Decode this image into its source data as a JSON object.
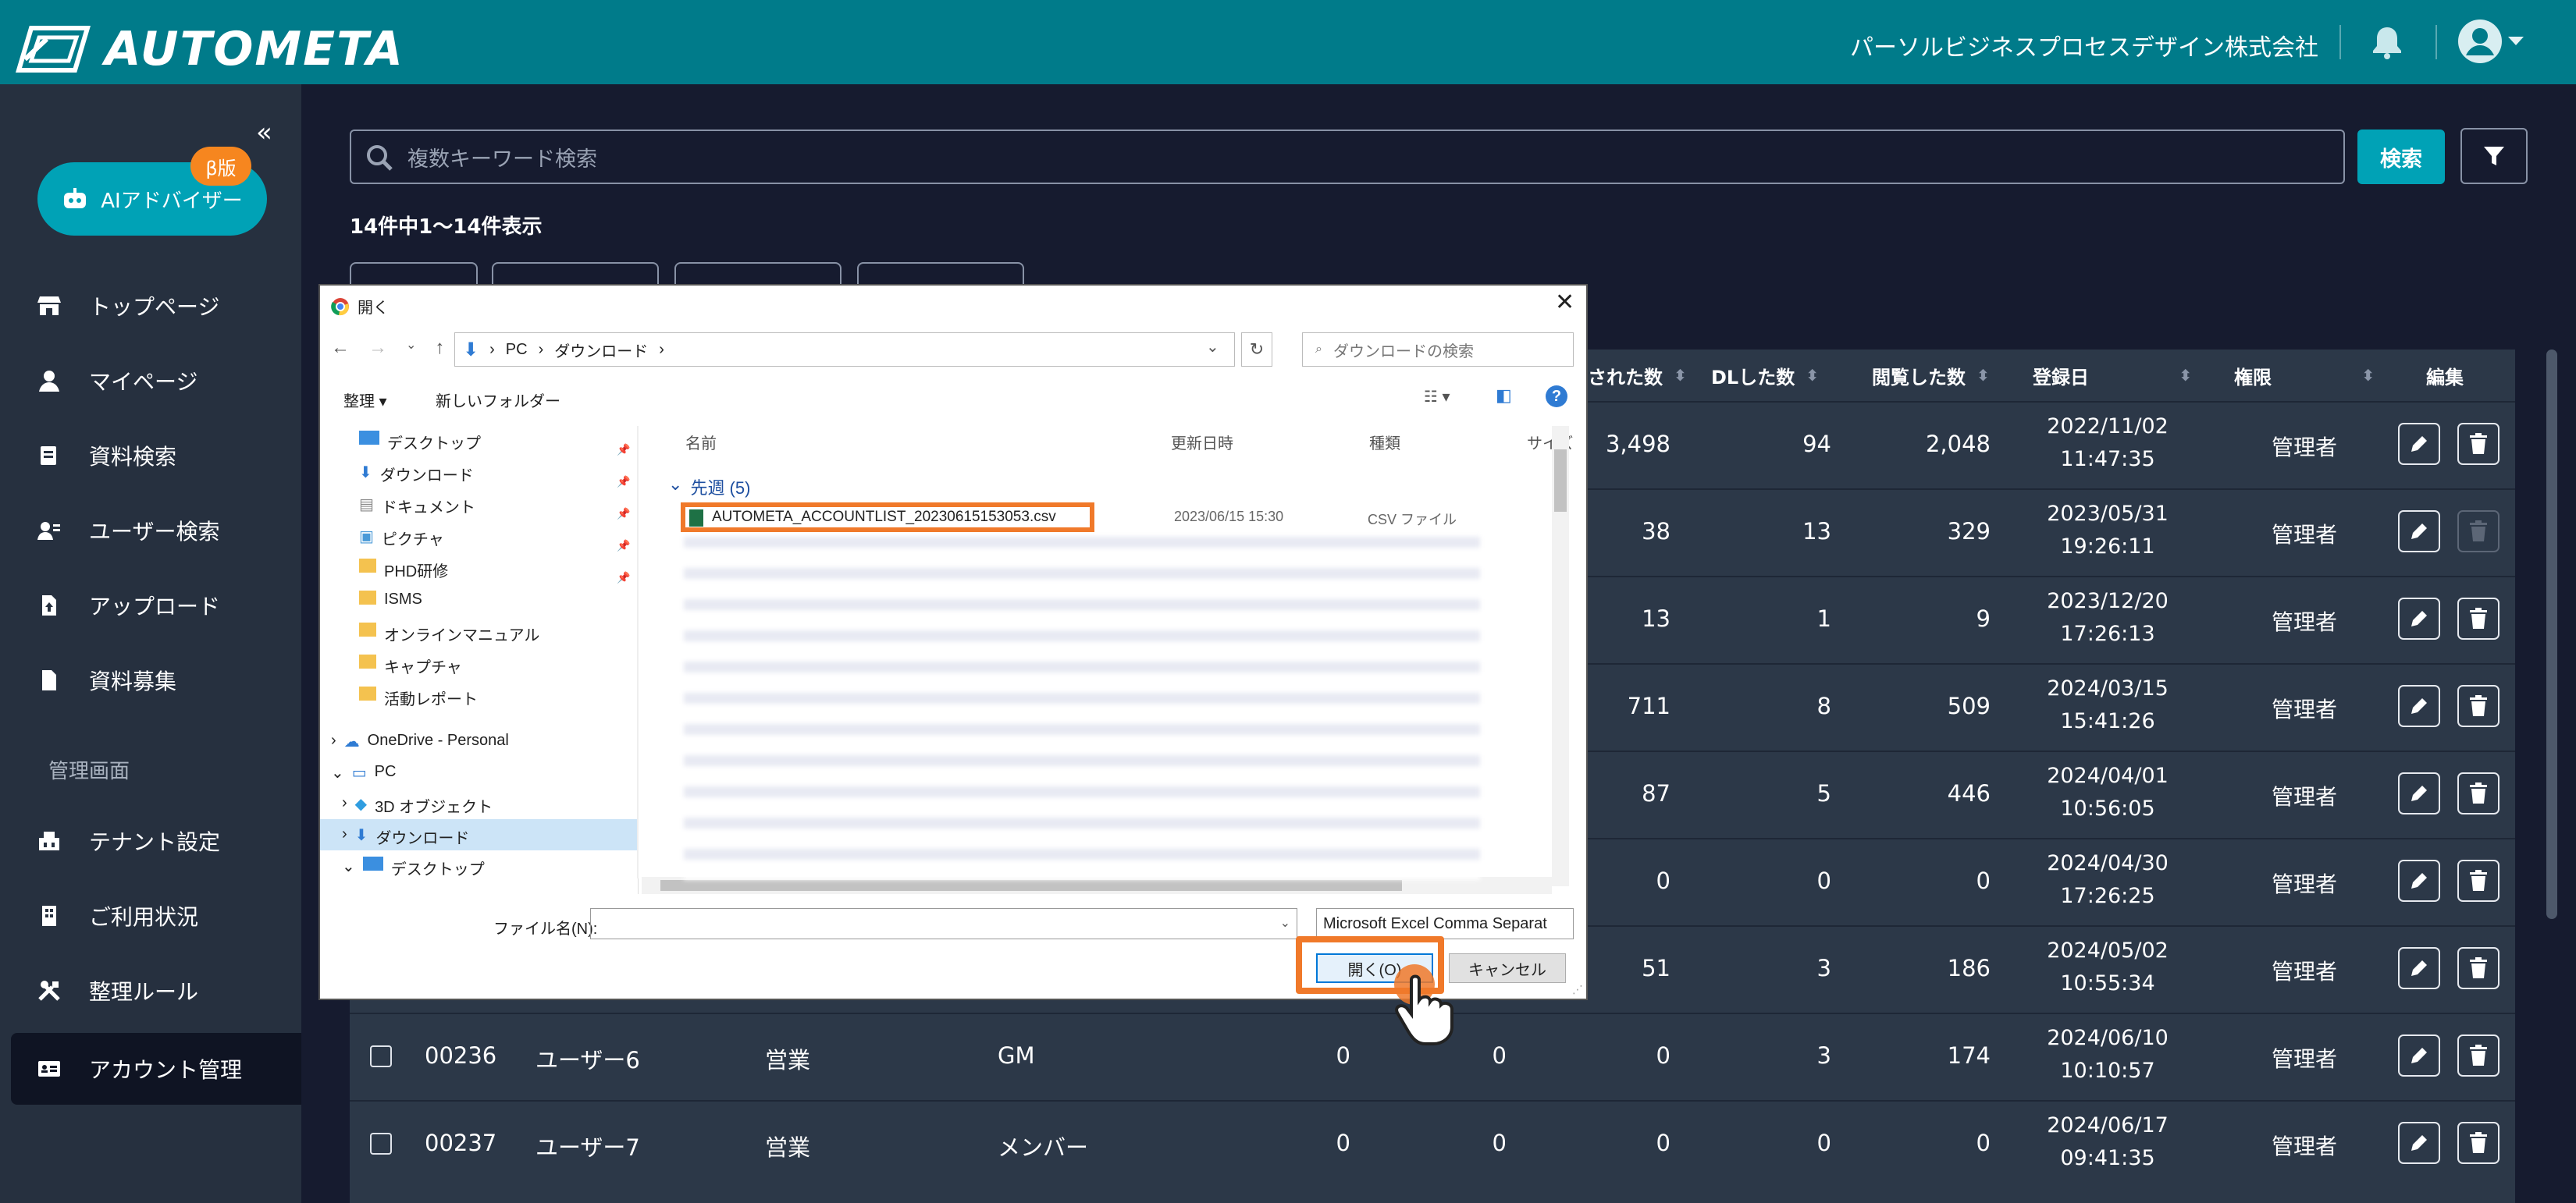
{
  "header": {
    "brand": "AUTOMETA",
    "company": "パーソルビジネスプロセスデザイン株式会社"
  },
  "sidebar": {
    "ai_label": "AIアドバイザー",
    "beta": "β版",
    "items": [
      {
        "label": "トップページ",
        "icon": "store-icon"
      },
      {
        "label": "マイページ",
        "icon": "person-icon"
      },
      {
        "label": "資料検索",
        "icon": "document-search-icon"
      },
      {
        "label": "ユーザー検索",
        "icon": "user-search-icon"
      },
      {
        "label": "アップロード",
        "icon": "upload-icon"
      },
      {
        "label": "資料募集",
        "icon": "file-icon"
      }
    ],
    "admin_title": "管理画面",
    "admin_items": [
      {
        "label": "テナント設定",
        "icon": "tenant-icon"
      },
      {
        "label": "ご利用状況",
        "icon": "building-icon"
      },
      {
        "label": "整理ルール",
        "icon": "tools-icon"
      },
      {
        "label": "アカウント管理",
        "icon": "account-card-icon"
      }
    ]
  },
  "search": {
    "placeholder": "複数キーワード検索",
    "button": "検索"
  },
  "count_text": "14件中1〜14件表示",
  "table": {
    "headers": {
      "downloaded": "された数",
      "dl": "DLした数",
      "viewed": "閲覧した数",
      "registered": "登録日",
      "role": "権限",
      "edit": "編集"
    },
    "rows": [
      {
        "c1": "3,498",
        "c2": "94",
        "c3": "2,048",
        "date": "2022/11/02",
        "time": "11:47:35",
        "role": "管理者",
        "delete_enabled": true
      },
      {
        "c1": "38",
        "c2": "13",
        "c3": "329",
        "date": "2023/05/31",
        "time": "19:26:11",
        "role": "管理者",
        "delete_enabled": false
      },
      {
        "c1": "13",
        "c2": "1",
        "c3": "9",
        "date": "2023/12/20",
        "time": "17:26:13",
        "role": "管理者",
        "delete_enabled": true
      },
      {
        "c1": "711",
        "c2": "8",
        "c3": "509",
        "date": "2024/03/15",
        "time": "15:41:26",
        "role": "管理者",
        "delete_enabled": true
      },
      {
        "c1": "87",
        "c2": "5",
        "c3": "446",
        "date": "2024/04/01",
        "time": "10:56:05",
        "role": "管理者",
        "delete_enabled": true
      },
      {
        "c1": "0",
        "c2": "0",
        "c3": "0",
        "date": "2024/04/30",
        "time": "17:26:25",
        "role": "管理者",
        "delete_enabled": true
      },
      {
        "c1": "51",
        "c2": "3",
        "c3": "186",
        "date": "2024/05/02",
        "time": "10:55:34",
        "role": "管理者",
        "delete_enabled": true
      },
      {
        "id": "00236",
        "name": "ユーザー6",
        "dept": "営業",
        "position": "GM",
        "a": "0",
        "b": "0",
        "c1": "0",
        "c2": "3",
        "c3": "174",
        "date": "2024/06/10",
        "time": "10:10:57",
        "role": "管理者",
        "delete_enabled": true
      },
      {
        "id": "00237",
        "name": "ユーザー7",
        "dept": "営業",
        "position": "メンバー",
        "a": "0",
        "b": "0",
        "c1": "0",
        "c2": "0",
        "c3": "0",
        "date": "2024/06/17",
        "time": "09:41:35",
        "role": "管理者",
        "delete_enabled": true
      }
    ]
  },
  "dialog": {
    "title": "開く",
    "path": [
      "PC",
      "ダウンロード"
    ],
    "search_placeholder": "ダウンロードの検索",
    "organize": "整理",
    "new_folder": "新しいフォルダー",
    "nav_items": [
      "デスクトップ",
      "ダウンロード",
      "ドキュメント",
      "ピクチャ",
      "PHD研修",
      "ISMS",
      "オンラインマニュアル",
      "キャプチャ",
      "活動レポート"
    ],
    "onedrive": "OneDrive - Personal",
    "pc": "PC",
    "pc_children": [
      "3D オブジェクト",
      "ダウンロード",
      "デスクトップ"
    ],
    "columns": {
      "name": "名前",
      "modified": "更新日時",
      "type": "種類",
      "size": "サイズ"
    },
    "group_label": "先週 (5)",
    "selected_file": {
      "name": "AUTOMETA_ACCOUNTLIST_20230615153053.csv",
      "modified": "2023/06/15 15:30",
      "type": "CSV ファイル"
    },
    "filename_label": "ファイル名(N):",
    "filetype": "Microsoft Excel Comma Separat",
    "open_button": "開く(O)",
    "cancel_button": "キャンセル"
  }
}
